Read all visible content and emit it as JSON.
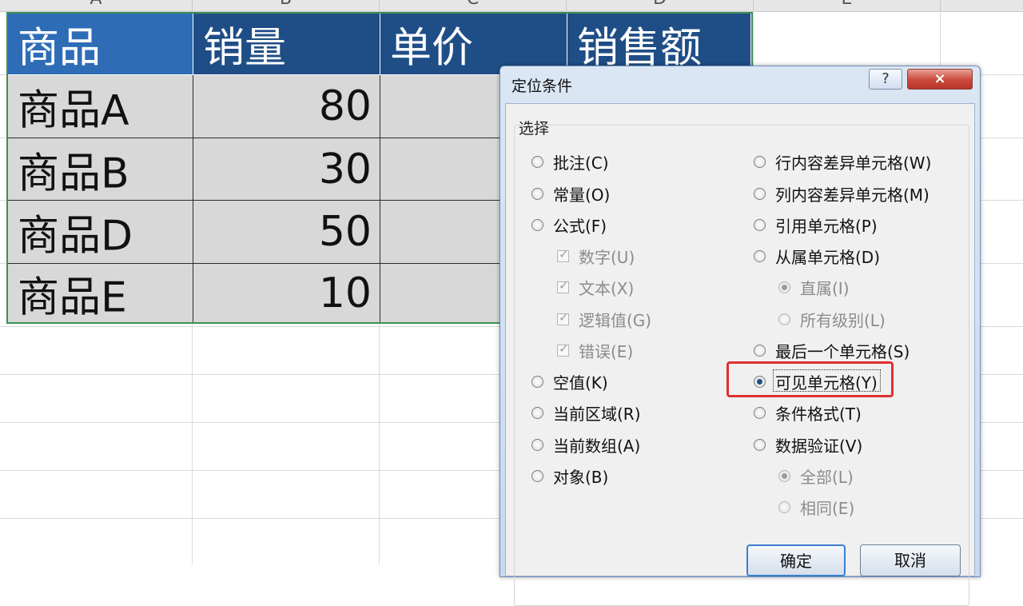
{
  "spreadsheet": {
    "column_letters": [
      "A",
      "B",
      "C",
      "D",
      "E"
    ],
    "header": [
      "商品",
      "销量",
      "单价",
      "销售额"
    ],
    "rows": [
      {
        "name": "商品A",
        "qty": "80"
      },
      {
        "name": "商品B",
        "qty": "30"
      },
      {
        "name": "商品D",
        "qty": "50"
      },
      {
        "name": "商品E",
        "qty": "10"
      }
    ]
  },
  "dialog": {
    "title": "定位条件",
    "help_label": "?",
    "close_label": "×",
    "group_label": "选择",
    "left_options": [
      {
        "label": "批注(C)",
        "kind": "radio",
        "checked": false,
        "disabled": false
      },
      {
        "label": "常量(O)",
        "kind": "radio",
        "checked": false,
        "disabled": false
      },
      {
        "label": "公式(F)",
        "kind": "radio",
        "checked": false,
        "disabled": false
      },
      {
        "label": "数字(U)",
        "kind": "check",
        "checked": true,
        "disabled": true
      },
      {
        "label": "文本(X)",
        "kind": "check",
        "checked": true,
        "disabled": true
      },
      {
        "label": "逻辑值(G)",
        "kind": "check",
        "checked": true,
        "disabled": true
      },
      {
        "label": "错误(E)",
        "kind": "check",
        "checked": true,
        "disabled": true
      },
      {
        "label": "空值(K)",
        "kind": "radio",
        "checked": false,
        "disabled": false
      },
      {
        "label": "当前区域(R)",
        "kind": "radio",
        "checked": false,
        "disabled": false
      },
      {
        "label": "当前数组(A)",
        "kind": "radio",
        "checked": false,
        "disabled": false
      },
      {
        "label": "对象(B)",
        "kind": "radio",
        "checked": false,
        "disabled": false
      }
    ],
    "right_options": [
      {
        "label": "行内容差异单元格(W)",
        "kind": "radio",
        "checked": false,
        "disabled": false
      },
      {
        "label": "列内容差异单元格(M)",
        "kind": "radio",
        "checked": false,
        "disabled": false
      },
      {
        "label": "引用单元格(P)",
        "kind": "radio",
        "checked": false,
        "disabled": false
      },
      {
        "label": "从属单元格(D)",
        "kind": "radio",
        "checked": false,
        "disabled": false
      },
      {
        "label": "直属(I)",
        "kind": "radio",
        "checked": true,
        "disabled": true
      },
      {
        "label": "所有级别(L)",
        "kind": "radio",
        "checked": false,
        "disabled": true
      },
      {
        "label": "最后一个单元格(S)",
        "kind": "radio",
        "checked": false,
        "disabled": false
      },
      {
        "label": "可见单元格(Y)",
        "kind": "radio",
        "checked": true,
        "disabled": false
      },
      {
        "label": "条件格式(T)",
        "kind": "radio",
        "checked": false,
        "disabled": false
      },
      {
        "label": "数据验证(V)",
        "kind": "radio",
        "checked": false,
        "disabled": false
      },
      {
        "label": "全部(L)",
        "kind": "radio",
        "checked": true,
        "disabled": true
      },
      {
        "label": "相同(E)",
        "kind": "radio",
        "checked": false,
        "disabled": true
      }
    ],
    "ok_label": "确定",
    "cancel_label": "取消"
  }
}
